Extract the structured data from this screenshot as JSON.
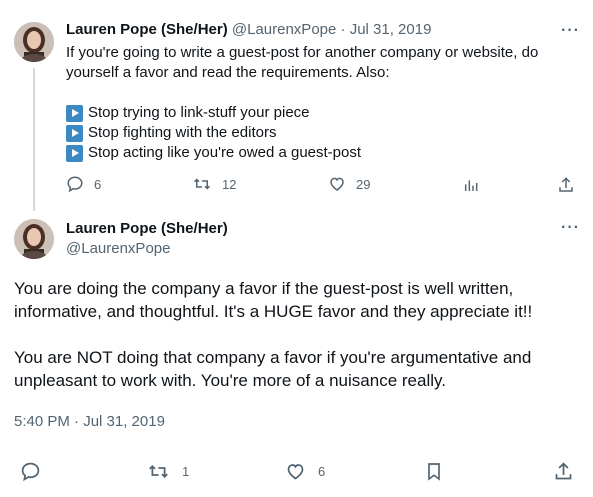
{
  "tweet1": {
    "author_name": "Lauren Pope (She/Her)",
    "handle": "@LaurenxPope",
    "separator": "·",
    "date": "Jul 31, 2019",
    "text_lines": [
      "If you're going to write a guest-post for another company or website, do",
      "yourself a favor and read the requirements. Also:"
    ],
    "bullets": [
      "Stop trying to link-stuff your piece",
      "Stop fighting with the editors",
      "Stop acting like you're owed a guest-post"
    ],
    "bullet_icon": "play-button-emoji",
    "replies": "6",
    "retweets": "12",
    "likes": "29",
    "more_label": "···"
  },
  "tweet2": {
    "author_name": "Lauren Pope (She/Her)",
    "handle": "@LaurenxPope",
    "paragraph1_lines": [
      "You are doing the company a favor if the guest-post is well written,",
      "informative, and thoughtful. It's a HUGE favor and they appreciate it!!"
    ],
    "paragraph2_lines": [
      "You are NOT doing that company a favor if you're argumentative and",
      "unpleasant to work with. You're more of a nuisance really."
    ],
    "timestamp": "5:40 PM · Jul 31, 2019",
    "retweets": "1",
    "likes": "6",
    "more_label": "···"
  },
  "colors": {
    "text": "#0f1419",
    "muted": "#536471",
    "thread_line": "#cfd9de",
    "bullet_blue": "#3b88c3"
  }
}
